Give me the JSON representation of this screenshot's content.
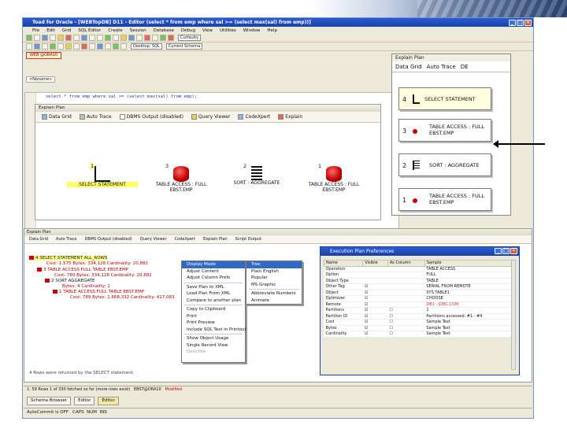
{
  "window": {
    "title": "Toad for Oracle - [WEBTopDB] D11 - Editor (select * from emp where sal >= (select max(sal) from emp))]",
    "controls": [
      "_",
      "□",
      "×"
    ]
  },
  "menu": [
    "File",
    "Edit",
    "Grid",
    "SQL Editor",
    "Create",
    "Session",
    "Database",
    "Debug",
    "View",
    "Utilities",
    "Window",
    "Help"
  ],
  "toolbar": {
    "combo_schema": "Curfaulty",
    "combo_desktop": "Desktop: SQL",
    "combo_current": "Current Schema"
  },
  "connection_tab": "WEB @ORA10",
  "editor_tab": "<Noname>",
  "editor": {
    "sql": "select * from emp where sal >= (select max(sal) from emp);"
  },
  "explain_plan": {
    "title": "Explain Plan",
    "tabs": [
      "Data Grid",
      "Auto Trace",
      "DBMS Output (disabled)",
      "Query Viewer",
      "CodeXpert",
      "Explain"
    ],
    "nodes": [
      {
        "order": "1",
        "label": "SELECT STATEMENT"
      },
      {
        "order": "3",
        "label": "TABLE ACCESS : FULL\nEBST.EMP"
      },
      {
        "order": "2",
        "label": "SORT : AGGREGATE"
      },
      {
        "order": "1",
        "label": "TABLE ACCESS : FULL\nEBST.EMP"
      }
    ]
  },
  "inset": {
    "title": "Explain Plan",
    "tabs": [
      "Data Grid",
      "Auto Trace",
      "DE"
    ],
    "boxes": [
      {
        "n": "4",
        "label": "SELECT STATEMENT"
      },
      {
        "n": "3",
        "label": "TABLE ACCESS : FULL\nEBST.EMP"
      },
      {
        "n": "2",
        "label": "SORT : AGGREGATE"
      },
      {
        "n": "1",
        "label": "TABLE ACCESS : FULL\nEBST.EMP"
      }
    ]
  },
  "lower": {
    "title": "Explain Plan",
    "tabs": [
      "Data Grid",
      "Auto Trace",
      "DBMS Output (disabled)",
      "Query Viewer",
      "CodeXpert",
      "Explain Plan",
      "Script Output"
    ],
    "rows": [
      {
        "text": "4 SELECT STATEMENT ALL_ROWS",
        "detail": "Cost: 1,575  Bytes: 334,128  Cardinality: 20,882"
      },
      {
        "text": "3 TABLE ACCESS FULL TABLE EBST.EMP",
        "detail": "Cost: 780  Bytes: 334,128  Cardinality: 20,882"
      },
      {
        "text": "2 SORT AGGREGATE",
        "detail": "Bytes: 4  Cardinality: 1"
      },
      {
        "text": "1 TABLE ACCESS FULL TABLE EBST.EMP",
        "detail": "Cost: 789  Bytes: 1,668,332  Cardinality: 417,083"
      }
    ],
    "footer": "4  Rows were returned by the SELECT statement."
  },
  "context_menu": {
    "items": [
      "Display Mode",
      "Adjust Content",
      "Adjust Column Prefs",
      "Save Plan to XML",
      "Load Plan From XML",
      "Compare to another plan",
      "Copy to Clipboard",
      "Print",
      "Print Preview",
      "Include SQL Text in Printout",
      "Show Object Usage",
      "Single Record View",
      "Describe"
    ],
    "sub_items": [
      "Tree",
      "Plain English",
      "Popular",
      "MS Graphic",
      "Abbreviate Numbers",
      "Animate"
    ]
  },
  "preferences": {
    "title": "Execution Plan Preferences",
    "headers": [
      "Name",
      "Visible",
      "As Column",
      "Sample"
    ],
    "rows": [
      {
        "name": "Operation",
        "visible": "",
        "col": "",
        "sample": "TABLE ACCESS",
        "red": false
      },
      {
        "name": "Option",
        "visible": "",
        "col": "",
        "sample": "FULL",
        "red": false
      },
      {
        "name": "Object Type",
        "visible": "",
        "col": "",
        "sample": "TABLE",
        "red": false
      },
      {
        "name": "Other Tag",
        "visible": "☑",
        "col": "",
        "sample": "SERIAL FROM REMOTE",
        "red": false
      },
      {
        "name": "Object",
        "visible": "☑",
        "col": "",
        "sample": "SYS.TABLE1",
        "red": false
      },
      {
        "name": "Optimizer",
        "visible": "☑",
        "col": "",
        "sample": "CHOOSE",
        "red": false
      },
      {
        "name": "Remote",
        "visible": "☑",
        "col": "",
        "sample": "DB1 - JDBC.COM",
        "red": true
      },
      {
        "name": "Partitions",
        "visible": "☑",
        "col": "☐",
        "sample": "1",
        "red": false
      },
      {
        "name": "Partition ID",
        "visible": "☑",
        "col": "☐",
        "sample": "Partitions accessed: #1 - #4",
        "red": false
      },
      {
        "name": "Cost",
        "visible": "☑",
        "col": "☐",
        "sample": "Sample Text",
        "red": false
      },
      {
        "name": "Bytes",
        "visible": "☑",
        "col": "☐",
        "sample": "Sample Text",
        "red": false
      },
      {
        "name": "Cardinality",
        "visible": "☑",
        "col": "☐",
        "sample": "Sample Text",
        "red": false
      }
    ]
  },
  "status": {
    "text": "1: 59  Rows 1 of 330 fetched so far (more rows exist)",
    "db": "EBST@ORA10",
    "modified": "Modified"
  },
  "taskbar": [
    "Schema Browser",
    "Editor",
    "Editor"
  ],
  "bottombar": [
    "AutoCommit is OFF",
    "CAPS",
    "NUM",
    "INS"
  ],
  "colors": {
    "accent": "#1941a5",
    "highlight": "#ffff66",
    "table_icon": "#c00000"
  }
}
